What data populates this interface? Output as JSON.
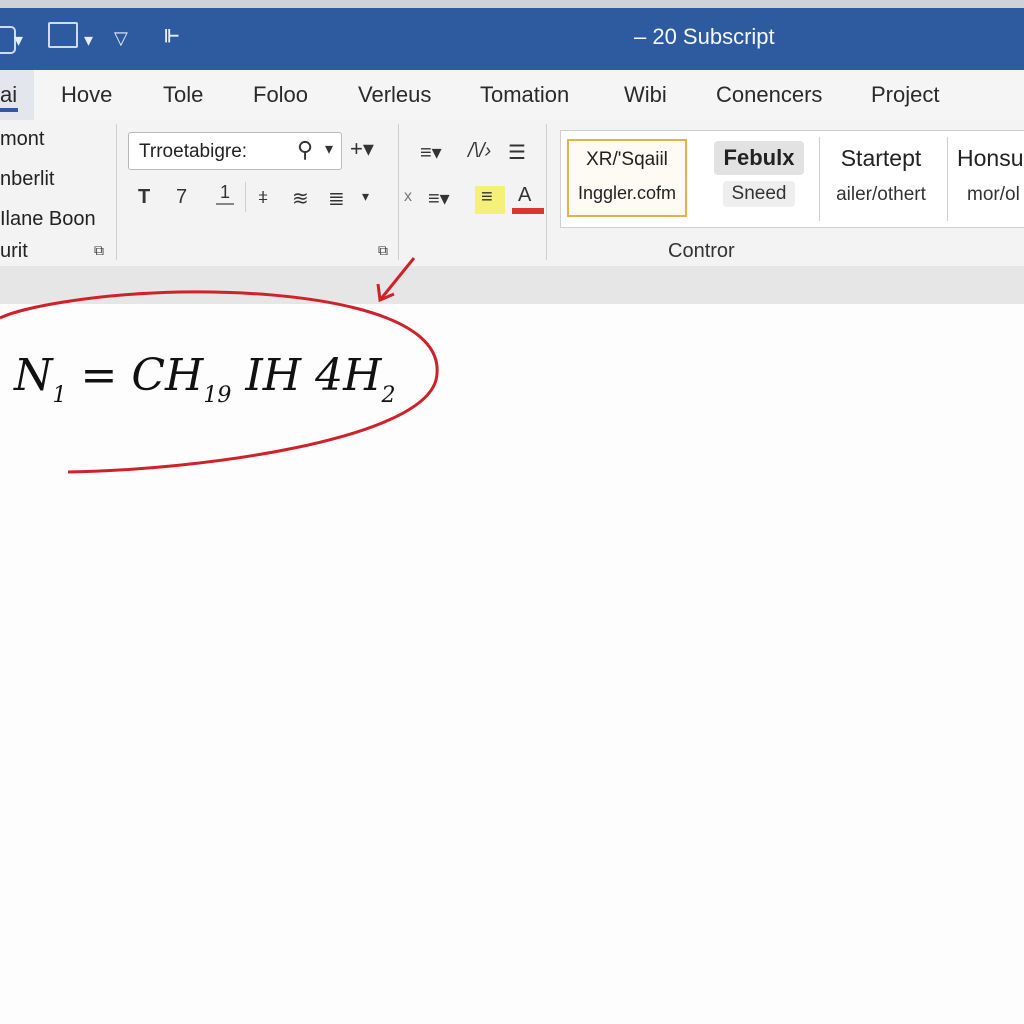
{
  "window": {
    "title": "– 20 Subscript"
  },
  "tabs": [
    "ai",
    "Hove",
    "Tole",
    "Foloo",
    "Verleus",
    "Tomation",
    "Wibi",
    "Conencers",
    "Project"
  ],
  "left_group": {
    "items": [
      "mont",
      "nberlit",
      "Ilane Boon",
      "urit"
    ]
  },
  "font": {
    "name": "Trroetabigre:",
    "buttons": [
      "T",
      "7",
      "1"
    ]
  },
  "styles": [
    {
      "top": "XR/'Sqaiil",
      "bottom": "Inggler.cofm"
    },
    {
      "top": "Febulx",
      "bottom": "Sneed"
    },
    {
      "top": "Startept",
      "bottom": "ailer/othert"
    },
    {
      "top": "Honsu",
      "bottom": "mor/ol"
    }
  ],
  "group_label": "Contror",
  "document": {
    "equation": {
      "n": "N",
      "n_sub": "1",
      "mid": " = CH",
      "mid_sub": "19",
      "tail": "  IH  4H",
      "tail_sub": "2"
    }
  },
  "colors": {
    "titlebar": "#2e5aa0",
    "annotation": "#d0202a",
    "highlight": "#f4f07a",
    "font_color": "#d93535"
  },
  "icons": [
    "dropdown-icon",
    "user-icon",
    "align-icon",
    "highlighter-icon",
    "font-color-icon"
  ]
}
